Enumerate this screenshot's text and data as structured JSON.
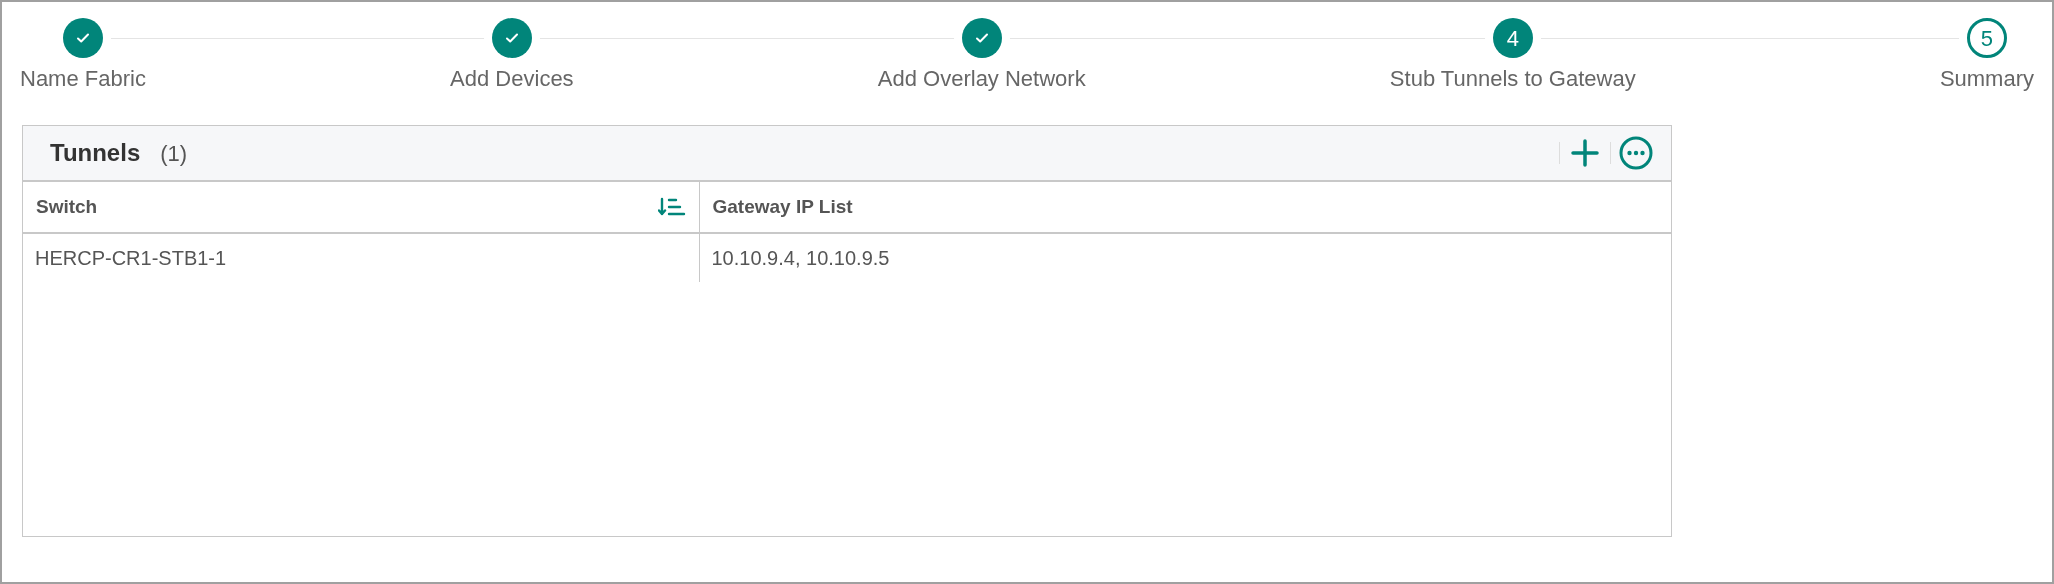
{
  "steps": [
    {
      "label": "Name Fabric",
      "kind": "done"
    },
    {
      "label": "Add Devices",
      "kind": "done"
    },
    {
      "label": "Add Overlay Network",
      "kind": "done"
    },
    {
      "label": "Stub Tunnels to Gateway",
      "kind": "current",
      "number": "4"
    },
    {
      "label": "Summary",
      "kind": "upcoming",
      "number": "5"
    }
  ],
  "panel": {
    "title": "Tunnels",
    "count": "(1)",
    "table": {
      "columns": [
        {
          "label": "Switch",
          "sorted": true
        },
        {
          "label": "Gateway IP List",
          "sorted": false
        }
      ],
      "rows": [
        [
          "HERCP-CR1-STB1-1",
          "10.10.9.4, 10.10.9.5"
        ]
      ]
    }
  }
}
